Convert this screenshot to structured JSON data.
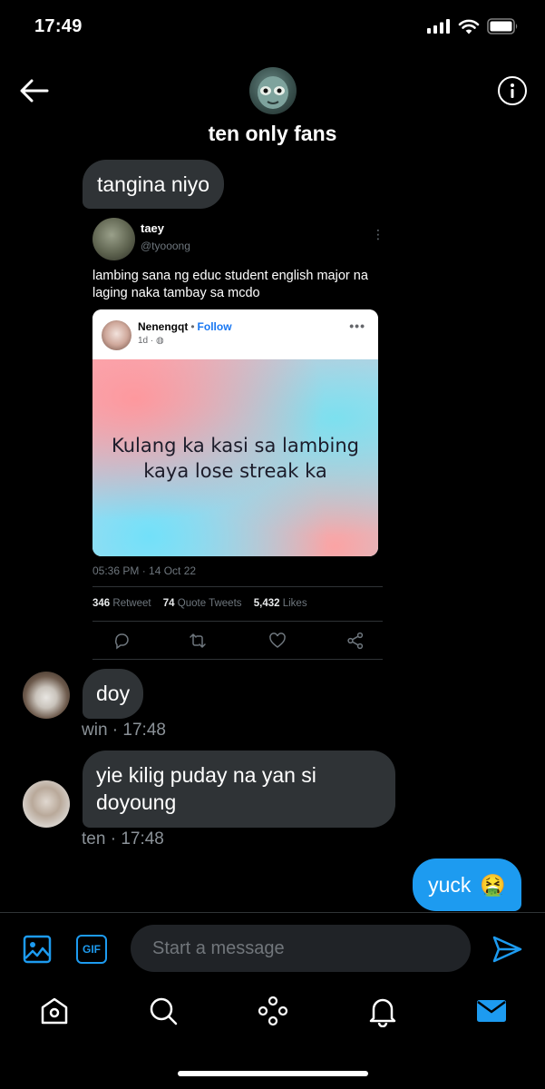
{
  "status_bar": {
    "time": "17:49"
  },
  "header": {
    "title": "ten only fans"
  },
  "messages": [
    {
      "type": "incoming",
      "text": "tangina niyo"
    },
    {
      "type": "incoming",
      "sender": "win",
      "time": "17:48",
      "text": "doy"
    },
    {
      "type": "incoming",
      "sender": "ten",
      "time": "17:48",
      "text": "yie kilig puday na yan si doyoung"
    },
    {
      "type": "outgoing",
      "text": "yuck",
      "emoji": "🤮"
    }
  ],
  "shared_tweet": {
    "name": "taey",
    "handle": "@tyooong",
    "text": "lambing sana ng educ student english major na laging naka tambay sa mcdo",
    "embedded_post": {
      "author": "Nenengqt",
      "follow_label": "Follow",
      "age": "1d",
      "image_text_line1": "Kulang ka kasi sa lambing",
      "image_text_line2": "kaya lose streak ka"
    },
    "datetime": "05:36 PM · 14 Oct 22",
    "retweets": "346",
    "retweets_label": "Retweet",
    "quote_tweets": "74",
    "quote_tweets_label": "Quote Tweets",
    "likes": "5,432",
    "likes_label": "Likes"
  },
  "composer": {
    "placeholder": "Start a message",
    "gif_label": "GIF"
  },
  "colors": {
    "accent": "#1d9bf0",
    "bubble_incoming": "#2f3336",
    "background": "#000000"
  }
}
